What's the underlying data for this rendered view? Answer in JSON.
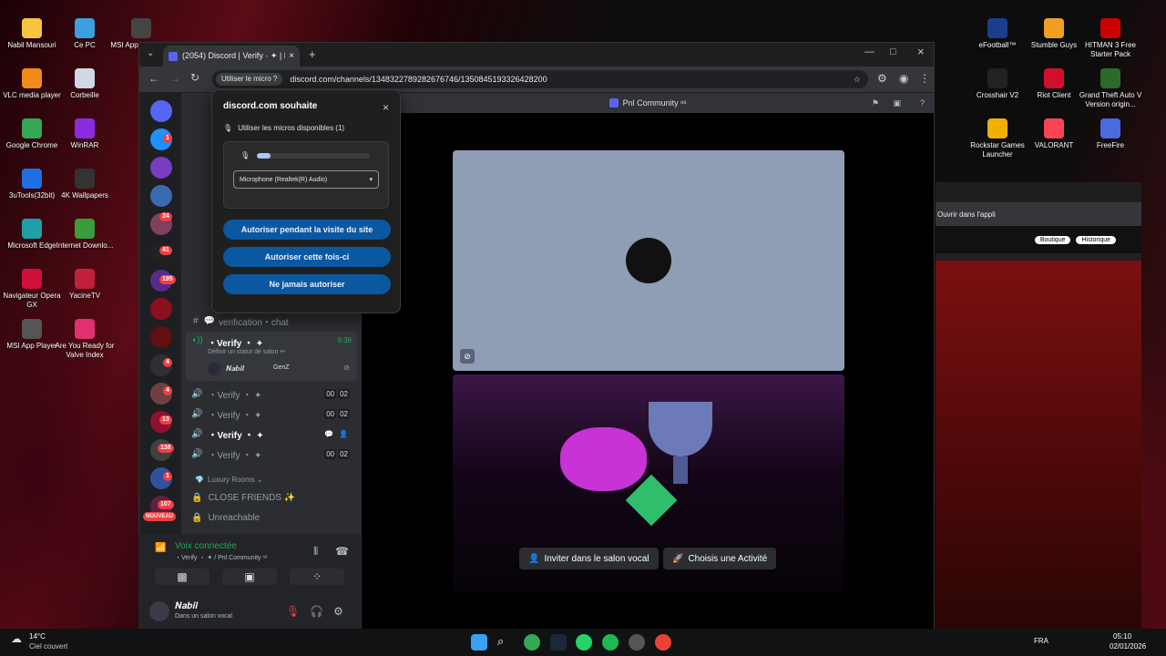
{
  "desktop": {
    "left_icons": [
      {
        "label": "Nabil Mansouri",
        "color": "#f5c542"
      },
      {
        "label": "Ce PC",
        "color": "#3aa0e0"
      },
      {
        "label": "MSI App Player En",
        "color": "#444"
      },
      {
        "label": "VLC media player",
        "color": "#f08a1c"
      },
      {
        "label": "Corbeille",
        "color": "#cfd8e3"
      },
      {
        "label": "Google Chrome",
        "color": "#34a853"
      },
      {
        "label": "WinRAR",
        "color": "#8a2be2"
      },
      {
        "label": "3uTools(32bit)",
        "color": "#1e6fe0"
      },
      {
        "label": "4K Wallpapers",
        "color": "#333"
      },
      {
        "label": "Microsoft Edge",
        "color": "#1fa0a8"
      },
      {
        "label": "Internet Downlo...",
        "color": "#3b9c3b"
      },
      {
        "label": "Navigateur Opera GX",
        "color": "#d0103a"
      },
      {
        "label": "YacineTV",
        "color": "#c0203a"
      },
      {
        "label": "MSI App Player",
        "color": "#555"
      },
      {
        "label": "Are You Ready for Valve Index",
        "color": "#e0306f"
      }
    ],
    "right_icons": [
      {
        "label": "eFootball™",
        "color": "#1a3f8a"
      },
      {
        "label": "Stumble Guys",
        "color": "#f0a020"
      },
      {
        "label": "HITMAN 3 Free Starter Pack",
        "color": "#c00"
      },
      {
        "label": "Crosshair V2",
        "color": "#222"
      },
      {
        "label": "Riot Client",
        "color": "#d0102a"
      },
      {
        "label": "Grand Theft Auto V Version origin...",
        "color": "#2a6a2a"
      },
      {
        "label": "Rockstar Games Launcher",
        "color": "#f0b000"
      },
      {
        "label": "VALORANT",
        "color": "#fa4454"
      },
      {
        "label": "FreeFire",
        "color": "#4a6ae0"
      }
    ],
    "weather_temp": "14°C",
    "weather_desc": "Ciel couvert",
    "lang": "FRA",
    "time": "05:10",
    "date": "02/01/2026"
  },
  "browser": {
    "tab_title": "(2054) Discord | Verify · ✦ | Pr",
    "site_chip": "Utiliser le micro ?",
    "url": "discord.com/channels/1348322789282676746/1350845193326428200",
    "open_in_app": "Ouvrir dans l'appli"
  },
  "permission_popup": {
    "title": "discord.com souhaite",
    "request": "Utiliser les micros disponibles (1)",
    "mic_level": 0.08,
    "device": "Microphone (Realtek(R) Audio)",
    "btn_allow_visit": "Autoriser pendant la visite du site",
    "btn_allow_once": "Autoriser cette fois-ci",
    "btn_never": "Ne jamais autoriser"
  },
  "discord": {
    "server_name": "Pnl Community ⁿˢ",
    "channels": {
      "verification_chat": "verification・chat",
      "active_vc": "・Verify ・ ✦",
      "active_vc_time": "9:36",
      "status_prompt": "Définir un statut de salon ✏",
      "member_name": "𝑵𝒂𝒃𝒊𝒍",
      "member_tag": "GenZ",
      "vc_rows": [
        {
          "name": "・Verify ・ ✦",
          "c1": "00",
          "c2": "02"
        },
        {
          "name": "・Verify ・ ✦",
          "c1": "00",
          "c2": "02"
        },
        {
          "name": "・Verify ・ ✦",
          "c1": "",
          "c2": ""
        },
        {
          "name": "・Verify ・ ✦",
          "c1": "00",
          "c2": "02"
        }
      ],
      "category": "Luxury Rooms ⌄",
      "close_friends": "CLOSE FRIENDS ✨",
      "unreachable": "Unreachable"
    },
    "guild_badges": [
      "1",
      "24",
      "41",
      "195",
      "4",
      "4",
      "13",
      "138",
      "1",
      "107"
    ],
    "new_label": "NOUVEAU",
    "voice_status": "Voix connectée",
    "voice_channel": "・Verify ・ ✦ / Pnl Community ⁿˢ",
    "user_name": "𝑵𝒂𝒃𝒊𝒍",
    "user_status": "Dans un salon vocal",
    "invite_btn": "Inviter dans le salon vocal",
    "activity_btn": "Choisis une Activité"
  },
  "right_window": {
    "boutique": "Boutique",
    "historique": "Historique"
  }
}
